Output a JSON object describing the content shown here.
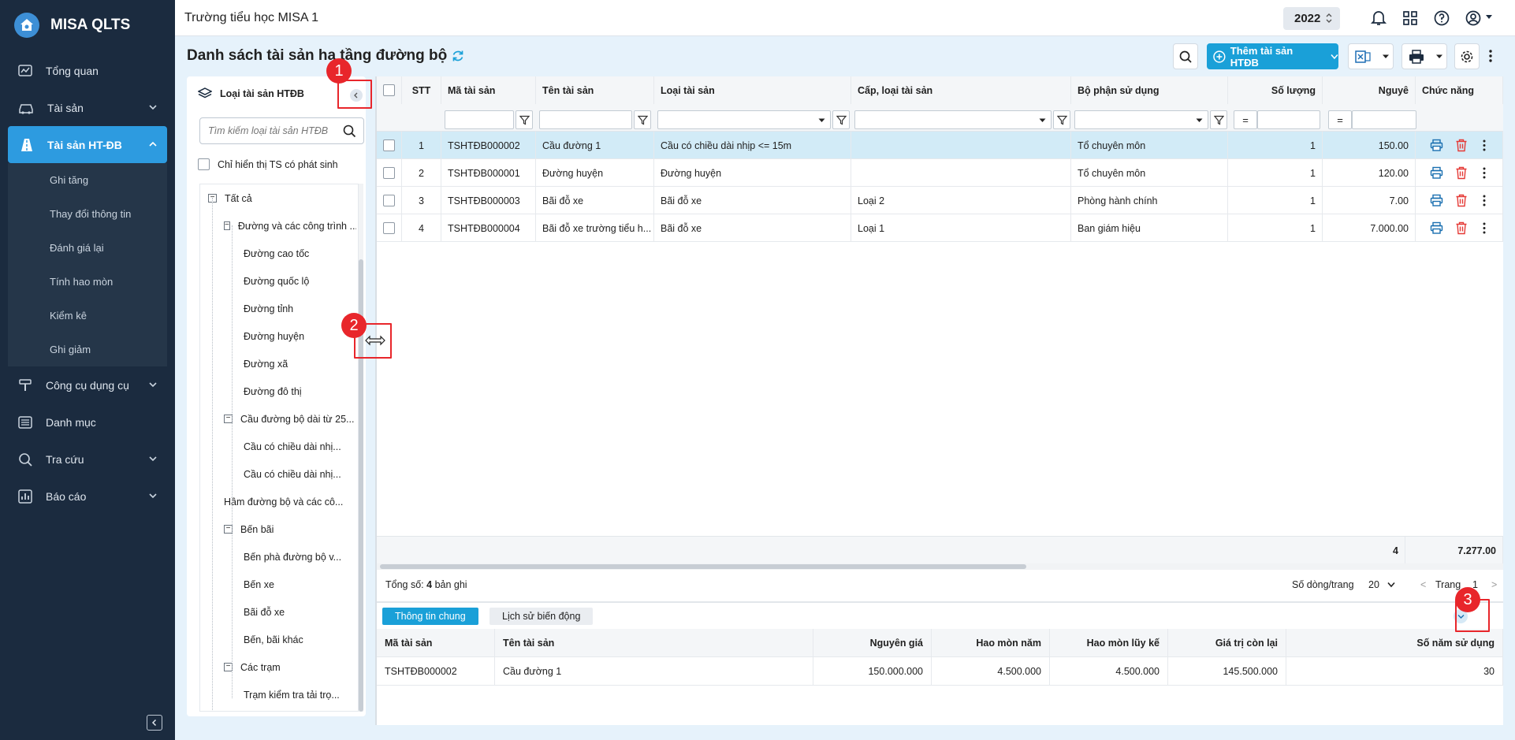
{
  "app": {
    "name": "MISA QLTS"
  },
  "sidebar": {
    "items": [
      {
        "label": "Tổng quan",
        "icon": "dashboard-icon"
      },
      {
        "label": "Tài sản",
        "icon": "car-icon"
      },
      {
        "label": "Tài sản HT-ĐB",
        "icon": "road-icon"
      },
      {
        "label": "Công cụ dụng cụ",
        "icon": "tool-icon"
      },
      {
        "label": "Danh mục",
        "icon": "list-icon"
      },
      {
        "label": "Tra cứu",
        "icon": "search-icon"
      },
      {
        "label": "Báo cáo",
        "icon": "chart-icon"
      }
    ],
    "submenu": [
      "Ghi tăng",
      "Thay đổi thông tin",
      "Đánh giá lại",
      "Tính hao mòn",
      "Kiểm kê",
      "Ghi giảm"
    ]
  },
  "topbar": {
    "school": "Trường tiểu học MISA 1",
    "year": "2022"
  },
  "page": {
    "title": "Danh sách tài sản hạ tầng đường bộ",
    "add_button": "Thêm tài sản HTĐB"
  },
  "tree": {
    "title": "Loại tài sản HTĐB",
    "search_placeholder": "Tìm kiếm loại tài sản HTĐB",
    "checkbox_label": "Chỉ hiển thị TS có phát sinh",
    "nodes": [
      {
        "label": "Tất cả",
        "level": 0,
        "toggle": "−"
      },
      {
        "label": "Đường và các công trình ...",
        "level": 1,
        "toggle": "−"
      },
      {
        "label": "Đường cao tốc",
        "level": 2
      },
      {
        "label": "Đường quốc lộ",
        "level": 2
      },
      {
        "label": "Đường tỉnh",
        "level": 2
      },
      {
        "label": "Đường huyện",
        "level": 2
      },
      {
        "label": "Đường xã",
        "level": 2
      },
      {
        "label": "Đường đô thị",
        "level": 2
      },
      {
        "label": "Cầu đường bộ dài từ 25...",
        "level": 1,
        "toggle": "−"
      },
      {
        "label": "Cầu có chiều dài nhị...",
        "level": 2
      },
      {
        "label": "Cầu có chiều dài nhị...",
        "level": 2
      },
      {
        "label": "Hầm đường bộ và các cô...",
        "level": 1
      },
      {
        "label": "Bến bãi",
        "level": 1,
        "toggle": "−"
      },
      {
        "label": "Bến phà đường bộ v...",
        "level": 2
      },
      {
        "label": "Bến xe",
        "level": 2
      },
      {
        "label": "Bãi đỗ xe",
        "level": 2
      },
      {
        "label": "Bến, bãi khác",
        "level": 2
      },
      {
        "label": "Các trạm",
        "level": 1,
        "toggle": "−"
      },
      {
        "label": "Trạm kiểm tra tải trọ...",
        "level": 2
      }
    ]
  },
  "grid": {
    "columns": [
      "STT",
      "Mã tài sản",
      "Tên tài sản",
      "Loại tài sản",
      "Cấp, loại tài sản",
      "Bộ phận sử dụng",
      "Số lượng",
      "Nguyê",
      "Chức năng"
    ],
    "filter_eq": "=",
    "rows": [
      {
        "stt": "1",
        "ma": "TSHTĐB000002",
        "ten": "Cầu đường 1",
        "loai": "Cầu có chiều dài nhịp <= 15m",
        "cap": "",
        "bophan": "Tổ chuyên môn",
        "sl": "1",
        "ng": "150.00"
      },
      {
        "stt": "2",
        "ma": "TSHTĐB000001",
        "ten": "Đường huyện",
        "loai": "Đường huyện",
        "cap": "",
        "bophan": "Tổ chuyên môn",
        "sl": "1",
        "ng": "120.00"
      },
      {
        "stt": "3",
        "ma": "TSHTĐB000003",
        "ten": "Bãi đỗ xe",
        "loai": "Bãi đỗ xe",
        "cap": "Loại 2",
        "bophan": "Phòng hành chính",
        "sl": "1",
        "ng": "7.00"
      },
      {
        "stt": "4",
        "ma": "TSHTĐB000004",
        "ten": "Bãi đỗ xe trường tiểu h...",
        "loai": "Bãi đỗ xe",
        "cap": "Loại 1",
        "bophan": "Ban giám hiệu",
        "sl": "1",
        "ng": "7.000.00"
      }
    ],
    "summary": {
      "sl": "4",
      "ng": "7.277.00"
    },
    "pager": {
      "total_prefix": "Tổng số:",
      "total": "4",
      "total_suffix": "bản ghi",
      "rows_label": "Số dòng/trang",
      "rows_value": "20",
      "page_label": "Trang",
      "page": "1",
      "prev": "<",
      "next": ">"
    }
  },
  "detail": {
    "tabs": [
      "Thông tin chung",
      "Lịch sử biến động"
    ],
    "columns": [
      "Mã tài sản",
      "Tên tài sản",
      "Nguyên giá",
      "Hao mòn năm",
      "Hao mòn lũy kế",
      "Giá trị còn lại",
      "Số năm sử dụng"
    ],
    "row": [
      "TSHTĐB000002",
      "Cầu đường 1",
      "150.000.000",
      "4.500.000",
      "4.500.000",
      "145.500.000",
      "30"
    ]
  },
  "annotations": [
    "1",
    "2",
    "3"
  ],
  "colors": {
    "sidebar": "#1b2b3f",
    "accent": "#1aa0d8",
    "marker": "#e8262b",
    "selected_row": "#d2ebf7"
  }
}
